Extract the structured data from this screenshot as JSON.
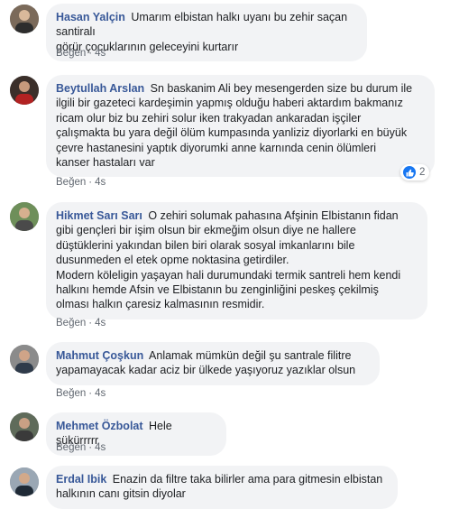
{
  "comments": [
    {
      "name": "Hasan Yalçin",
      "text": "Umarım elbistan halkı uyanı bu zehir saçan santiralı\ngörür çocuklarının geleceyini kurtarır",
      "like_label": "Beğen",
      "time": "4s"
    },
    {
      "name": "Beytullah Arslan",
      "text": "Sn baskanim Ali bey mesengerden size bu durum ile\nilgili bir gazeteci kardeşimin yapmış olduğu haberi aktardım bakmanız\nricam olur biz bu zehiri solur iken trakyadan ankaradan işçiler\nçalışmakta bu yara değil ölüm kumpasında yanliziz diyorlarki en büyük\nçevre hastanesini yaptık diyorumki anne karnında cenin ölümleri\nkanser hastaları var",
      "like_label": "Beğen",
      "time": "4s",
      "reaction_count": "2"
    },
    {
      "name": "Hikmet Sarı Sarı",
      "text": "O zehiri solumak pahasına Afşinin Elbistanın fidan\ngibi gençleri bir işim olsun bir ekmeğim olsun diye ne hallere\ndüştüklerini yakından bilen biri olarak sosyal imkanlarını bile\ndusunmeden el etek opme noktasina getirdiler.\nModern köleligin yaşayan hali durumundaki termik santreli hem kendi\nhalkını hemde Afsin ve Elbistanın bu zenginliğini peskeş çekilmiş\nolması halkın çaresiz kalmasının resmidir.",
      "like_label": "Beğen",
      "time": "4s"
    },
    {
      "name": "Mahmut Çoşkun",
      "text": "Anlamak mümkün değil şu santrale filitre\nyapamayacak kadar aciz bir ülkede yaşıyoruz yazıklar olsun",
      "like_label": "Beğen",
      "time": "4s"
    },
    {
      "name": "Mehmet Özbolat",
      "text": "Hele şükürrrrr",
      "like_label": "Beğen",
      "time": "4s"
    },
    {
      "name": "Erdal Ibik",
      "text": "Enazin da filtre taka bilirler ama para gitmesin elbistan\nhalkının canı gitsin diyolar"
    }
  ],
  "separator": "·"
}
